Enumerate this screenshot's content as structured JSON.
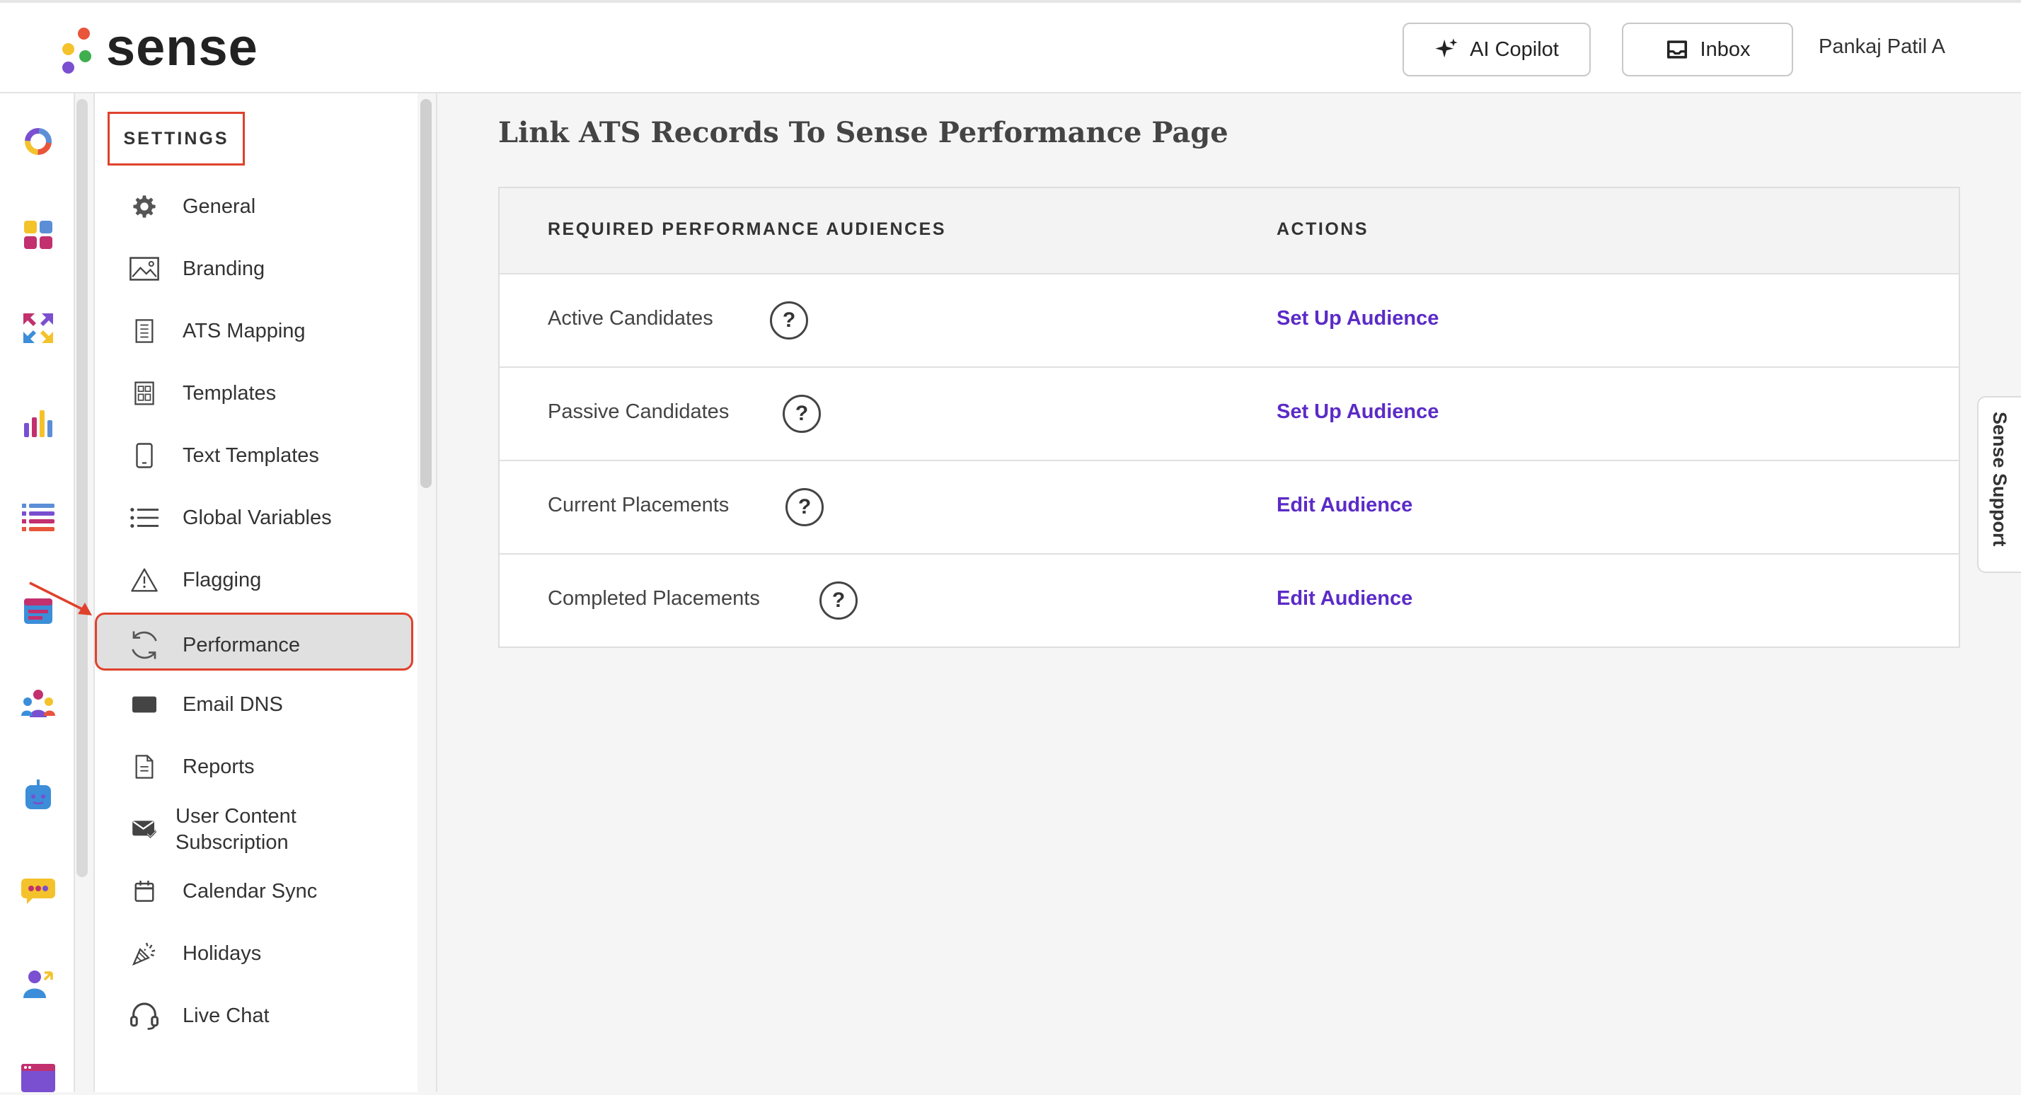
{
  "app": {
    "logo_text": "sense",
    "brand_color": "#5b2bc7",
    "highlight_color": "#e0412c"
  },
  "header": {
    "copilot_label": "AI Copilot",
    "inbox_label": "Inbox",
    "user_name": "Pankaj Patil A"
  },
  "rail": {
    "icons": [
      "dashboard-ring-icon",
      "apps-grid-icon",
      "sync-arrows-icon",
      "bar-chart-icon",
      "list-icon",
      "calendar-icon",
      "team-icon",
      "chatbot-icon",
      "messages-icon",
      "user-referral-icon",
      "browser-window-icon"
    ]
  },
  "settings": {
    "title": "SETTINGS",
    "items": [
      {
        "label": "General",
        "icon": "gear-icon"
      },
      {
        "label": "Branding",
        "icon": "image-icon"
      },
      {
        "label": "ATS Mapping",
        "icon": "document-icon"
      },
      {
        "label": "Templates",
        "icon": "template-icon"
      },
      {
        "label": "Text Templates",
        "icon": "phone-icon"
      },
      {
        "label": "Global Variables",
        "icon": "list-icon"
      },
      {
        "label": "Flagging",
        "icon": "warning-icon"
      },
      {
        "label": "Performance",
        "icon": "refresh-icon",
        "active": true
      },
      {
        "label": "Email DNS",
        "icon": "email-icon"
      },
      {
        "label": "Reports",
        "icon": "report-icon"
      },
      {
        "label": "User Content\nSubscription",
        "icon": "mail-check-icon"
      },
      {
        "label": "Calendar Sync",
        "icon": "calendar-icon"
      },
      {
        "label": "Holidays",
        "icon": "confetti-icon"
      },
      {
        "label": "Live Chat",
        "icon": "headset-icon"
      }
    ]
  },
  "main": {
    "title": "Link ATS Records To Sense Performance Page",
    "columns": [
      "REQUIRED PERFORMANCE AUDIENCES",
      "ACTIONS"
    ],
    "rows": [
      {
        "name": "Active Candidates",
        "action": "Set Up Audience"
      },
      {
        "name": "Passive Candidates",
        "action": "Set Up Audience"
      },
      {
        "name": "Current Placements",
        "action": "Edit Audience"
      },
      {
        "name": "Completed Placements",
        "action": "Edit Audience"
      }
    ],
    "help_glyph": "?"
  },
  "support_tab": {
    "label": "Sense Support"
  }
}
